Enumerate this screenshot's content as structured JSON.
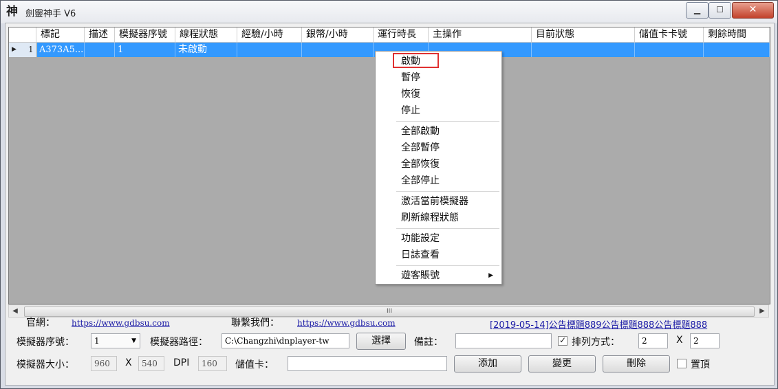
{
  "window": {
    "title": "劍靈神手 V6",
    "icon": "神",
    "min_label": "▁",
    "max_label": "☐",
    "close_label": "✕"
  },
  "grid": {
    "columns": [
      "標記",
      "描述",
      "模擬器序號",
      "線程狀態",
      "經驗/小時",
      "銀幣/小時",
      "運行時長",
      "主操作",
      "目前狀態",
      "儲值卡卡號",
      "剩餘時間"
    ],
    "rows": [
      {
        "indicator": "▶",
        "index": "1",
        "cells": [
          "A373A5...",
          "",
          "1",
          "未啟動",
          "",
          "",
          "",
          "",
          "",
          "",
          ""
        ]
      }
    ]
  },
  "scrollbar": {
    "left_arrow": "◀",
    "right_arrow": "▶",
    "grip": "III"
  },
  "context_menu": {
    "items": [
      {
        "label": "啟動"
      },
      {
        "label": "暫停"
      },
      {
        "label": "恢復"
      },
      {
        "label": "停止"
      },
      {
        "label": "全部啟動"
      },
      {
        "label": "全部暫停"
      },
      {
        "label": "全部恢復"
      },
      {
        "label": "全部停止"
      },
      {
        "label": "激活當前模擬器"
      },
      {
        "label": "刷新線程狀態"
      },
      {
        "label": "功能設定"
      },
      {
        "label": "日誌查看"
      },
      {
        "label": "遊客賬號",
        "submenu_arrow": "▶"
      }
    ]
  },
  "footer": {
    "official_label": "官網：",
    "official_url": "https://www.gdbsu.com",
    "contact_label": "聯繫我們：",
    "contact_url": "https://www.gdbsu.com",
    "announcement": "[2019-05-14]公告標題889公告標題888公告標題888",
    "emulator_index_label": "模擬器序號：",
    "emulator_index_value": "1",
    "emulator_path_label": "模擬器路徑：",
    "emulator_path_value": "C:\\Changzhi\\dnplayer-tw",
    "choose_button": "選擇",
    "note_label": "備註：",
    "note_value": "",
    "sort_checked": true,
    "sort_label": "排列方式：",
    "sort_cols": "2",
    "sort_x": "X",
    "sort_rows": "2",
    "size_label": "模擬器大小：",
    "width": "960",
    "size_x": "X",
    "height": "540",
    "dpi_label": "DPI",
    "dpi": "160",
    "card_label": "儲值卡：",
    "card_value": "",
    "add_button": "添加",
    "change_button": "變更",
    "delete_button": "刪除",
    "topmost_checked": false,
    "topmost_label": "置頂"
  }
}
